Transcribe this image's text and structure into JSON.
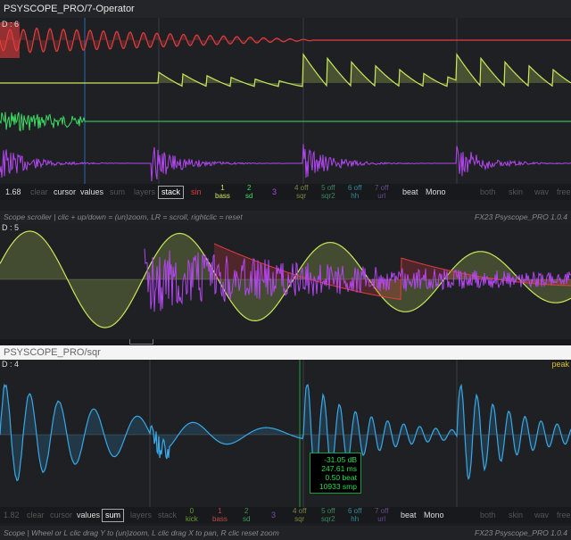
{
  "colors": {
    "scope_bg": "#1e2024",
    "red": "#e43c3c",
    "yellow_green": "#c8e85a",
    "green": "#3ddc64",
    "purple": "#b246ee",
    "cyan": "#3aa8e6",
    "readout_green": "#22dd55"
  },
  "window1": {
    "title": "PSYSCOPE_PRO/7-Operator",
    "corner_label": "D : 6"
  },
  "toolbar1": {
    "zoom": "1.68",
    "clear": "clear",
    "cursor": "cursor",
    "values": "values",
    "sum": "sum",
    "layers": "layers",
    "stack": "stack",
    "ch1": "sin",
    "ch2_num": "1",
    "ch2_name": "bass",
    "ch3_num": "2",
    "ch3_name": "sd",
    "ch4": "3",
    "ch5_top": "4 off",
    "ch5_bot": "sqr",
    "ch6_top": "5 off",
    "ch6_bot": "sqr2",
    "ch7_top": "6 off",
    "ch7_bot": "hh",
    "ch8_top": "7 off",
    "ch8_bot": "url",
    "beat": "beat",
    "mono": "Mono",
    "both": "both",
    "skin": "skin",
    "wav": "wav",
    "free": "free"
  },
  "status1": {
    "hint": "Scope scroller | clic + up/down = (un)zoom, LR = scroll, rightclic = reset",
    "version": "FX23 Psyscope_PRO 1.0.4"
  },
  "middle": {
    "corner_label": "D : 5"
  },
  "window2": {
    "title": "PSYSCOPE_PRO/sqr",
    "corner_label": "D : 4",
    "corner_right": "peak"
  },
  "readout": {
    "db": "-31.05 dB",
    "ms": "247.61 ms",
    "beat": "0.50 beat",
    "smp": "10933 smp"
  },
  "toolbar2": {
    "zoom": "1.82",
    "clear": "clear",
    "cursor": "cursor",
    "values": "values",
    "sum": "sum",
    "layers": "layers",
    "stack": "stack",
    "ch0_num": "0",
    "ch0_name": "kick",
    "ch1_num": "1",
    "ch1_name": "bass",
    "ch2_num": "2",
    "ch2_name": "sd",
    "ch3": "3",
    "ch4_top": "4 off",
    "ch4_bot": "sqr",
    "ch5_top": "5 off",
    "ch5_bot": "sqr2",
    "ch6_top": "6 off",
    "ch6_bot": "hh",
    "ch7_top": "7 off",
    "ch7_bot": "url",
    "beat": "beat",
    "mono": "Mono",
    "both": "both",
    "skin": "skin",
    "wav": "wav",
    "free": "free"
  },
  "status2": {
    "hint": "Scope | Wheel or L clic drag Y to (un)zoom, L clic drag X to pan, R clic reset zoom",
    "version": "FX23 Psyscope_PRO 1.0.4"
  }
}
